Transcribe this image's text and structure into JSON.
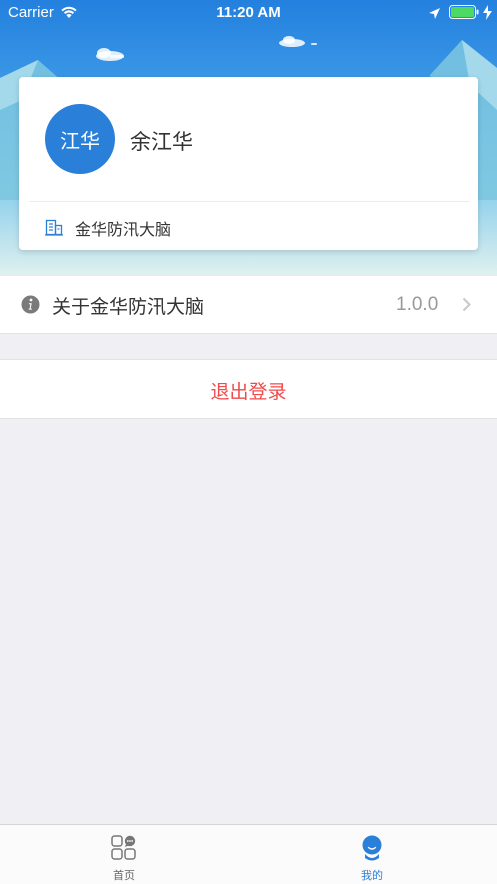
{
  "status_bar": {
    "carrier": "Carrier",
    "time": "11:20 AM",
    "icons": [
      "wifi-icon",
      "location-arrow-icon",
      "battery-icon",
      "charging-bolt-icon"
    ]
  },
  "profile": {
    "avatar_text": "江华",
    "name": "余江华",
    "organization": "金华防汛大脑",
    "organization_icon": "building-icon"
  },
  "about": {
    "label": "关于金华防汛大脑",
    "version": "1.0.0",
    "icon": "info-icon"
  },
  "logout": {
    "label": "退出登录"
  },
  "tab_bar": {
    "items": [
      {
        "label": "首页",
        "icon": "grid-chat-icon",
        "active": false
      },
      {
        "label": "我的",
        "icon": "person-icon",
        "active": true
      }
    ]
  },
  "colors": {
    "accent": "#2a7fd9",
    "danger": "#f04a4a",
    "background": "#efeff4"
  }
}
